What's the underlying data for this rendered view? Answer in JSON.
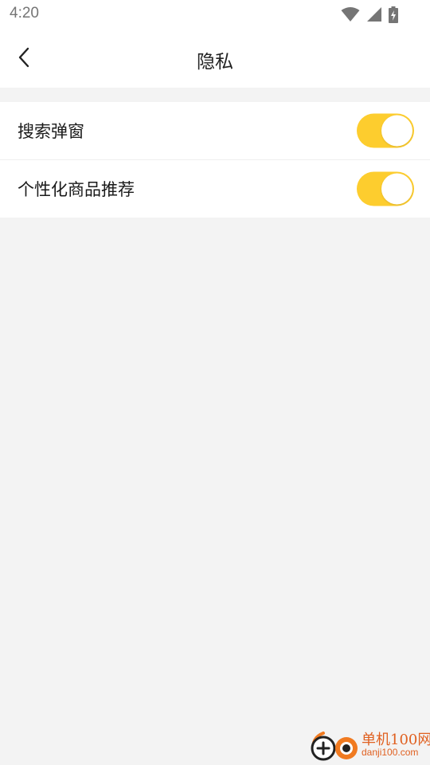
{
  "status_bar": {
    "time": "4:20",
    "icons": [
      "wifi-icon",
      "cell-signal-icon",
      "battery-charging-icon"
    ]
  },
  "header": {
    "back_icon": "chevron-left-icon",
    "title": "隐私"
  },
  "settings": [
    {
      "label": "搜索弹窗",
      "enabled": true
    },
    {
      "label": "个性化商品推荐",
      "enabled": true
    }
  ],
  "colors": {
    "accent": "#fdcd2e",
    "background": "#f3f3f3",
    "watermark": "#e06020"
  },
  "watermark": {
    "name": "单机100网",
    "url": "danji100.com"
  }
}
